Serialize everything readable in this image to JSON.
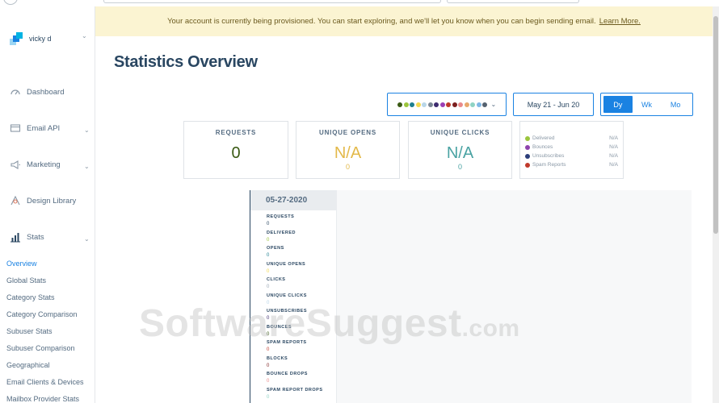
{
  "banner": {
    "message": "Your account is currently being provisioned. You can start exploring, and we'll let you know when you can begin sending email.",
    "link": "Learn More."
  },
  "sidebar": {
    "user": "vicky d",
    "nav": [
      "Dashboard",
      "Email API",
      "Marketing",
      "Design Library",
      "Stats"
    ],
    "stats_sub": [
      "Overview",
      "Global Stats",
      "Category Stats",
      "Category Comparison",
      "Subuser Stats",
      "Subuser Comparison",
      "Geographical",
      "Email Clients & Devices",
      "Mailbox Provider Stats"
    ]
  },
  "page": {
    "title": "Statistics Overview"
  },
  "controls": {
    "color_dots": [
      "#3a5a14",
      "#9bc53d",
      "#1e7f8f",
      "#f2d94e",
      "#b9d6e8",
      "#7a8694",
      "#3d2b6e",
      "#9b3fb5",
      "#c0392b",
      "#7b1e1e",
      "#e98a8a",
      "#e8a86b",
      "#8fd3c4",
      "#7fb8e6",
      "#556270"
    ],
    "date_range": "May 21 - Jun 20",
    "ranges": [
      "Dy",
      "Wk",
      "Mo"
    ],
    "active_range": "Dy"
  },
  "cards": [
    {
      "label": "REQUESTS",
      "value": "0",
      "sub": "",
      "color": "#3a5a14"
    },
    {
      "label": "UNIQUE OPENS",
      "value": "N/A",
      "sub": "0",
      "color": "#e3b94a"
    },
    {
      "label": "UNIQUE CLICKS",
      "value": "N/A",
      "sub": "0",
      "color": "#4aa3a3"
    }
  ],
  "legend": [
    {
      "name": "Delivered",
      "value": "N/A",
      "color": "#9bc53d"
    },
    {
      "name": "Bounces",
      "value": "N/A",
      "color": "#8e44ad"
    },
    {
      "name": "Unsubscribes",
      "value": "N/A",
      "color": "#2c3e7a"
    },
    {
      "name": "Spam Reports",
      "value": "N/A",
      "color": "#c0392b"
    }
  ],
  "tooltip": {
    "date": "05-27-2020",
    "items": [
      {
        "label": "REQUESTS",
        "value": "0",
        "color": "#294661"
      },
      {
        "label": "DELIVERED",
        "value": "0",
        "color": "#9bc53d"
      },
      {
        "label": "OPENS",
        "value": "0",
        "color": "#1e7f8f"
      },
      {
        "label": "UNIQUE OPENS",
        "value": "0",
        "color": "#f2d94e"
      },
      {
        "label": "CLICKS",
        "value": "0",
        "color": "#9aa8b5"
      },
      {
        "label": "UNIQUE CLICKS",
        "value": "0",
        "color": "#b9d6e8"
      },
      {
        "label": "UNSUBSCRIBES",
        "value": "0",
        "color": "#3d2b6e"
      },
      {
        "label": "BOUNCES",
        "value": "0",
        "color": "#3a5a14"
      },
      {
        "label": "SPAM REPORTS",
        "value": "0",
        "color": "#c0392b"
      },
      {
        "label": "BLOCKS",
        "value": "0",
        "color": "#7b1e1e"
      },
      {
        "label": "BOUNCE DROPS",
        "value": "0",
        "color": "#e98a8a"
      },
      {
        "label": "SPAM REPORT DROPS",
        "value": "0",
        "color": "#8fd3c4"
      }
    ]
  },
  "watermark": {
    "main": "SoftwareSuggest",
    "suffix": ".com"
  }
}
